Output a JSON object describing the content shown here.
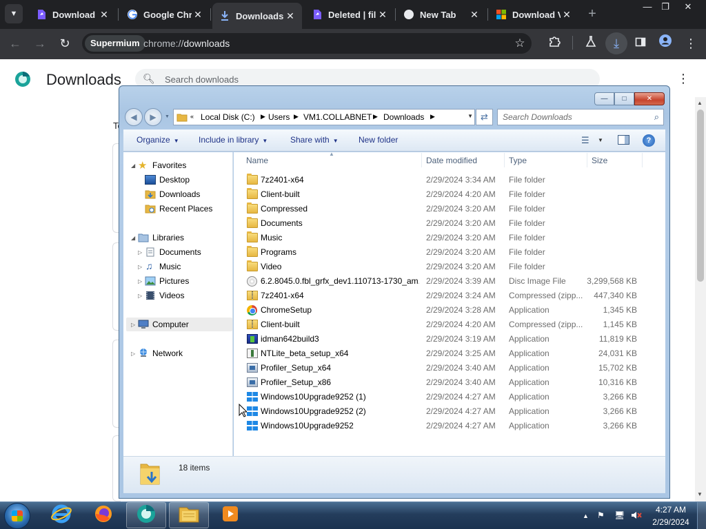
{
  "browser": {
    "tabs": [
      {
        "title": "Download |",
        "icon": "purple-doc-icon"
      },
      {
        "title": "Google Chr",
        "icon": "google-icon"
      },
      {
        "title": "Downloads",
        "icon": "download-icon",
        "active": true
      },
      {
        "title": "Deleted | fil",
        "icon": "purple-doc-icon"
      },
      {
        "title": "New Tab",
        "icon": "chrome-tab-icon"
      },
      {
        "title": "Download V",
        "icon": "windows-logo-icon"
      }
    ],
    "address_chip": "Supermium",
    "url_scheme": "chrome://",
    "url_path": "downloads"
  },
  "downloads_page": {
    "title": "Downloads",
    "search_placeholder": "Search downloads",
    "partial_text": "Te"
  },
  "explorer": {
    "breadcrumb": [
      "Local Disk (C:)",
      "Users",
      "VM1.COLLABNET",
      "Downloads"
    ],
    "search_placeholder": "Search Downloads",
    "commands": {
      "organize": "Organize",
      "include_in_library": "Include in library",
      "share_with": "Share with",
      "new_folder": "New folder"
    },
    "nav": {
      "favorites": "Favorites",
      "desktop": "Desktop",
      "downloads": "Downloads",
      "recent_places": "Recent Places",
      "libraries": "Libraries",
      "documents": "Documents",
      "music": "Music",
      "pictures": "Pictures",
      "videos": "Videos",
      "computer": "Computer",
      "network": "Network"
    },
    "columns": {
      "name": "Name",
      "date": "Date modified",
      "type": "Type",
      "size": "Size"
    },
    "files": [
      {
        "name": "7z2401-x64",
        "date": "2/29/2024 3:34 AM",
        "type": "File folder",
        "size": "",
        "icon": "folder"
      },
      {
        "name": "Client-built",
        "date": "2/29/2024 4:20 AM",
        "type": "File folder",
        "size": "",
        "icon": "folder"
      },
      {
        "name": "Compressed",
        "date": "2/29/2024 3:20 AM",
        "type": "File folder",
        "size": "",
        "icon": "folder"
      },
      {
        "name": "Documents",
        "date": "2/29/2024 3:20 AM",
        "type": "File folder",
        "size": "",
        "icon": "folder"
      },
      {
        "name": "Music",
        "date": "2/29/2024 3:20 AM",
        "type": "File folder",
        "size": "",
        "icon": "folder"
      },
      {
        "name": "Programs",
        "date": "2/29/2024 3:20 AM",
        "type": "File folder",
        "size": "",
        "icon": "folder"
      },
      {
        "name": "Video",
        "date": "2/29/2024 3:20 AM",
        "type": "File folder",
        "size": "",
        "icon": "folder"
      },
      {
        "name": "6.2.8045.0.fbl_grfx_dev1.110713-1730_am...",
        "date": "2/29/2024 3:39 AM",
        "type": "Disc Image File",
        "size": "3,299,568 KB",
        "icon": "disc"
      },
      {
        "name": "7z2401-x64",
        "date": "2/29/2024 3:24 AM",
        "type": "Compressed (zipp...",
        "size": "447,340 KB",
        "icon": "zip"
      },
      {
        "name": "ChromeSetup",
        "date": "2/29/2024 3:28 AM",
        "type": "Application",
        "size": "1,345 KB",
        "icon": "chrome"
      },
      {
        "name": "Client-built",
        "date": "2/29/2024 4:20 AM",
        "type": "Compressed (zipp...",
        "size": "1,145 KB",
        "icon": "zip"
      },
      {
        "name": "idman642build3",
        "date": "2/29/2024 3:19 AM",
        "type": "Application",
        "size": "11,819 KB",
        "icon": "idm"
      },
      {
        "name": "NTLite_beta_setup_x64",
        "date": "2/29/2024 3:25 AM",
        "type": "Application",
        "size": "24,031 KB",
        "icon": "setup"
      },
      {
        "name": "Profiler_Setup_x64",
        "date": "2/29/2024 3:40 AM",
        "type": "Application",
        "size": "15,702 KB",
        "icon": "app"
      },
      {
        "name": "Profiler_Setup_x86",
        "date": "2/29/2024 3:40 AM",
        "type": "Application",
        "size": "10,316 KB",
        "icon": "app"
      },
      {
        "name": "Windows10Upgrade9252 (1)",
        "date": "2/29/2024 4:27 AM",
        "type": "Application",
        "size": "3,266 KB",
        "icon": "win"
      },
      {
        "name": "Windows10Upgrade9252 (2)",
        "date": "2/29/2024 4:27 AM",
        "type": "Application",
        "size": "3,266 KB",
        "icon": "win"
      },
      {
        "name": "Windows10Upgrade9252",
        "date": "2/29/2024 4:27 AM",
        "type": "Application",
        "size": "3,266 KB",
        "icon": "win"
      }
    ],
    "item_count": "18 items"
  },
  "taskbar": {
    "apps": [
      "internet-explorer-icon",
      "firefox-icon",
      "supermium-icon",
      "file-explorer-icon",
      "media-player-icon"
    ],
    "time": "4:27 AM",
    "date": "2/29/2024"
  }
}
